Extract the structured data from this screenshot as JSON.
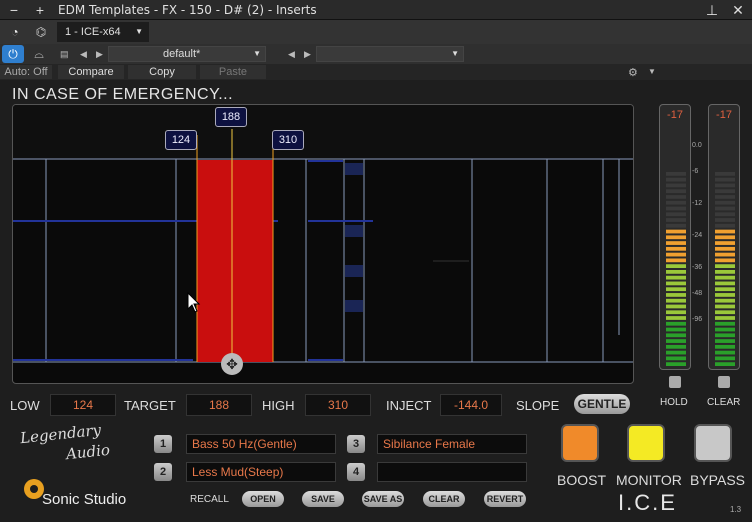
{
  "window": {
    "title": "EDM Templates - FX - 150 - D# (2) - Inserts"
  },
  "toolbar": {
    "plugin_tab": "1 - ICE-x64",
    "preset_name": "default*",
    "auto_label": "Auto: Off",
    "compare_label": "Compare",
    "copy_label": "Copy",
    "paste_label": "Paste"
  },
  "plugin": {
    "title": "IN CASE OF EMERGENCY...",
    "markers": {
      "low": "124",
      "target": "188",
      "high": "310"
    },
    "controls": {
      "low_label": "LOW",
      "low_value": "124",
      "target_label": "TARGET",
      "target_value": "188",
      "high_label": "HIGH",
      "high_value": "310",
      "inject_label": "INJECT",
      "inject_value": "-144.0",
      "slope_label": "SLOPE",
      "slope_value": "GENTLE"
    },
    "meters": {
      "left_peak": "-17",
      "right_peak": "-17",
      "scale": [
        "0.0",
        "-6",
        "-12",
        "-24",
        "-36",
        "-48",
        "-96"
      ],
      "hold_label": "HOLD",
      "clear_label": "CLEAR",
      "level_fraction": 0.7
    },
    "presets": {
      "slot1_num": "1",
      "slot1_name": "Bass 50 Hz(Gentle)",
      "slot2_num": "2",
      "slot2_name": "Less Mud(Steep)",
      "slot3_num": "3",
      "slot3_name": "Sibilance Female",
      "slot4_num": "4",
      "slot4_name": "",
      "recall_label": "RECALL",
      "open_label": "OPEN",
      "save_label": "SAVE",
      "saveas_label": "SAVE AS",
      "clear_label": "CLEAR",
      "revert_label": "REVERT"
    },
    "buttons": {
      "boost_label": "BOOST",
      "monitor_label": "MONITOR",
      "bypass_label": "BYPASS",
      "boost_color": "#f08a2a",
      "monitor_color": "#f4ea24",
      "bypass_color": "#c8c8c8"
    },
    "brand": {
      "logo_line1": "Legendary",
      "logo_line2": "Audio",
      "studio": "Sonic Studio",
      "product": "I.C.E",
      "version": "1.3"
    }
  }
}
